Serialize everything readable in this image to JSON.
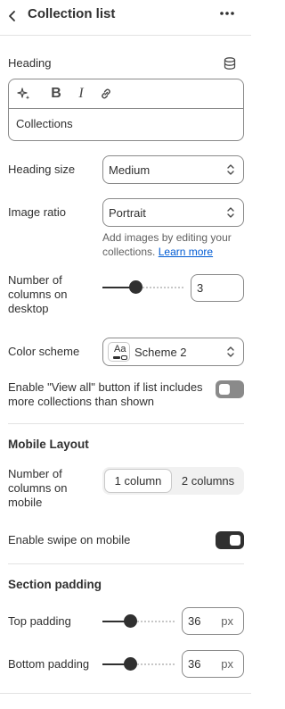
{
  "header": {
    "title": "Collection list"
  },
  "heading": {
    "label": "Heading",
    "value": "Collections",
    "toolbar": {
      "bold": "B",
      "italic": "I"
    }
  },
  "heading_size": {
    "label": "Heading size",
    "value": "Medium"
  },
  "image_ratio": {
    "label": "Image ratio",
    "value": "Portrait",
    "hint": "Add images by editing your collections.",
    "hint_link": "Learn more"
  },
  "columns_desktop": {
    "label": "Number of columns on desktop",
    "value": "3",
    "fraction": 0.4
  },
  "color_scheme": {
    "label": "Color scheme",
    "value": "Scheme 2",
    "swatch_text": "Aa"
  },
  "view_all": {
    "label": "Enable \"View all\" button if list includes more collections than shown",
    "enabled": false
  },
  "mobile_layout": {
    "title": "Mobile Layout",
    "columns_label": "Number of columns on mobile",
    "options": [
      "1 column",
      "2 columns"
    ],
    "selected": "1 column",
    "swipe_label": "Enable swipe on mobile",
    "swipe_enabled": true
  },
  "section_padding": {
    "title": "Section padding",
    "top": {
      "label": "Top padding",
      "value": "36",
      "unit": "px"
    },
    "bottom": {
      "label": "Bottom padding",
      "value": "36",
      "unit": "px"
    }
  },
  "colors": {
    "text": "#303030",
    "border": "#8a8a8a",
    "link": "#005bd3",
    "toggle_off": "#8a8a8a",
    "toggle_on": "#303030"
  }
}
